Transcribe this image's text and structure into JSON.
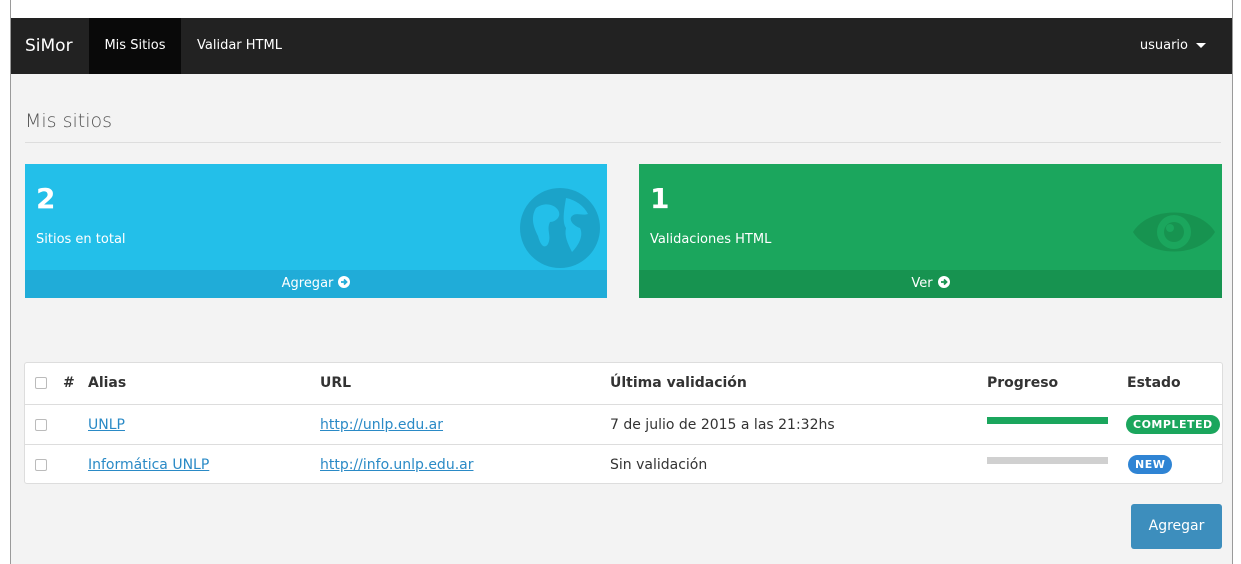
{
  "navbar": {
    "brand": "SiMor",
    "items": [
      {
        "label": "Mis Sitios",
        "active": true
      },
      {
        "label": "Validar HTML",
        "active": false
      }
    ],
    "user": "usuario"
  },
  "page": {
    "title": "Mis sitios"
  },
  "panels": [
    {
      "count": "2",
      "label": "Sitios en total",
      "action": "Agregar",
      "color": "#23bfe9",
      "icon": "globe-icon"
    },
    {
      "count": "1",
      "label": "Validaciones HTML",
      "action": "Ver",
      "color": "#1ba65d",
      "icon": "eye-icon"
    }
  ],
  "table": {
    "headers": {
      "hash": "#",
      "alias": "Alias",
      "url": "URL",
      "last": "Última validación",
      "progress": "Progreso",
      "status": "Estado"
    },
    "rows": [
      {
        "alias": "UNLP",
        "url": "http://unlp.edu.ar",
        "last": "7 de julio de 2015 a las 21:32hs",
        "progress": 1.0,
        "status": "COMPLETED",
        "status_color": "#1ba65d"
      },
      {
        "alias": "Informática UNLP",
        "url": "http://info.unlp.edu.ar",
        "last": "Sin validación",
        "progress": 0.0,
        "status": "NEW",
        "status_color": "#2f84d4"
      }
    ]
  },
  "add_button": "Agregar"
}
